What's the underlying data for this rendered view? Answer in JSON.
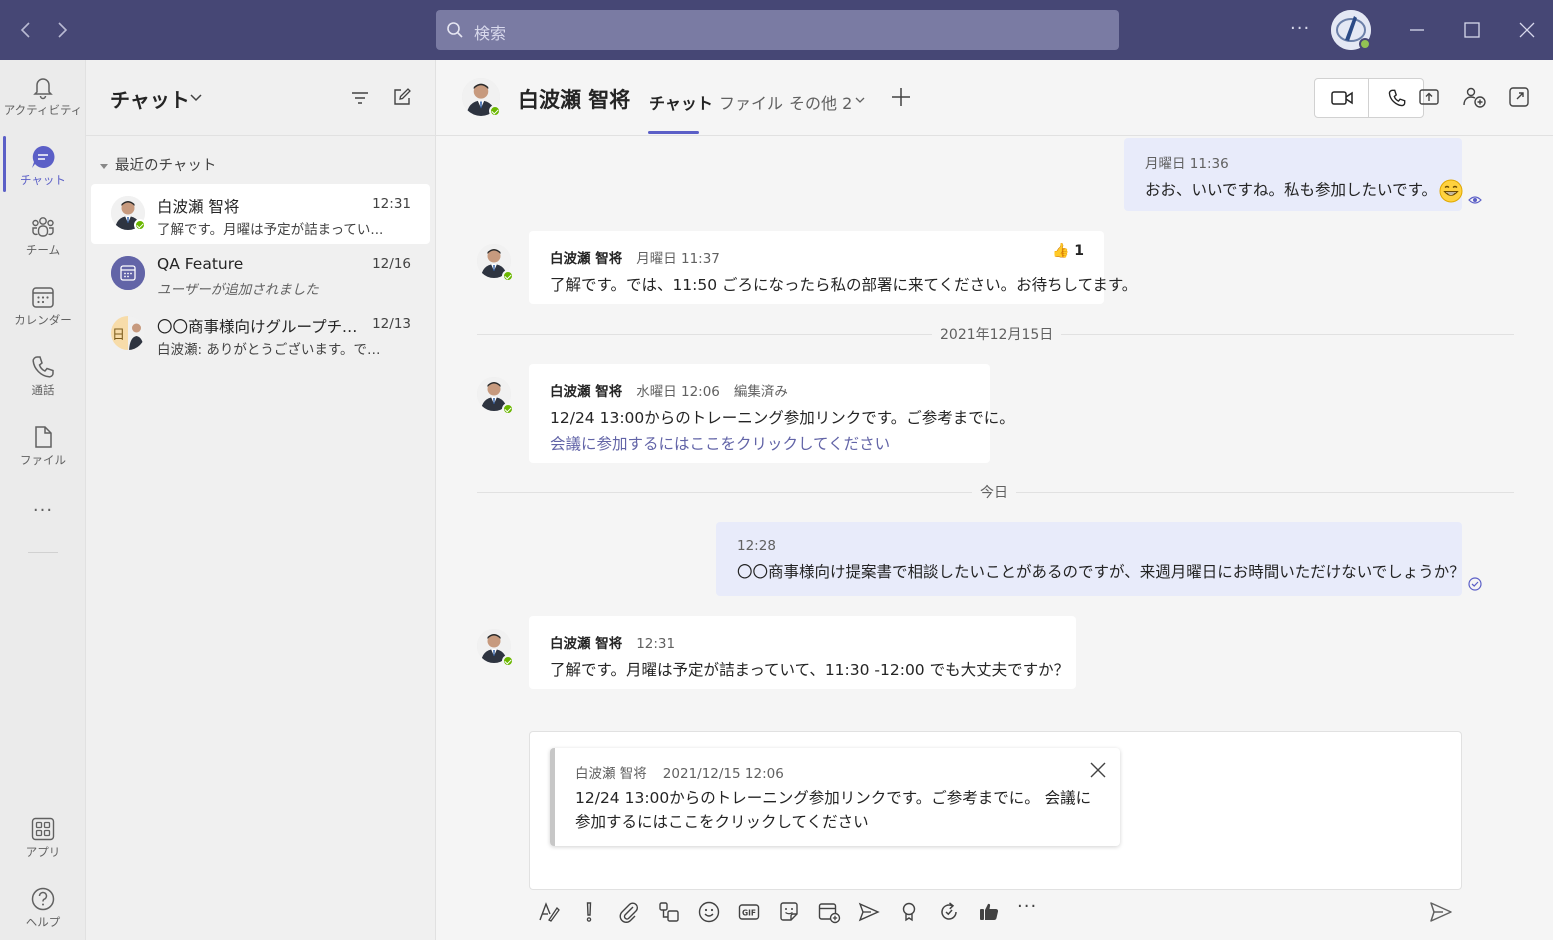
{
  "titlebar": {
    "search_placeholder": "検索",
    "more": "···"
  },
  "rail": {
    "items": [
      {
        "label": "アクティビティ",
        "icon": "bell-icon"
      },
      {
        "label": "チャット",
        "icon": "chat-icon"
      },
      {
        "label": "チーム",
        "icon": "teams-icon"
      },
      {
        "label": "カレンダー",
        "icon": "calendar-icon"
      },
      {
        "label": "通話",
        "icon": "phone-icon"
      },
      {
        "label": "ファイル",
        "icon": "file-icon"
      }
    ],
    "more": "···",
    "apps": {
      "label": "アプリ",
      "icon": "apps-icon"
    },
    "help": {
      "label": "ヘルプ",
      "icon": "help-icon"
    }
  },
  "chatlist": {
    "title": "チャット",
    "section": "最近のチャット",
    "items": [
      {
        "name": "白波瀬 智将",
        "time": "12:31",
        "preview": "了解です。月曜は予定が詰まってい..."
      },
      {
        "name": "QA Feature",
        "time": "12/16",
        "preview": "ユーザーが追加されました"
      },
      {
        "name": "〇〇商事様向けグループチャ...",
        "time": "12/13",
        "preview": "白波瀬: ありがとうございます。では、...",
        "avatar_char": "日"
      }
    ]
  },
  "header": {
    "name": "白波瀬 智将",
    "tabs": [
      "チャット",
      "ファイル",
      "その他 2"
    ]
  },
  "messages": [
    {
      "meta": "月曜日 11:36",
      "text": "おお、いいですね。私も参加したいです。",
      "emoji": "😁"
    },
    {
      "author": "白波瀬 智将",
      "meta": "月曜日 11:37",
      "text": "了解です。では、11:50 ごろになったら私の部署に来てください。お待ちしてます。",
      "reaction": "👍",
      "reaction_count": "1"
    },
    {
      "author": "白波瀬 智将",
      "meta": "水曜日 12:06",
      "edited": "編集済み",
      "text": "12/24 13:00からのトレーニング参加リンクです。ご参考までに。",
      "link": "会議に参加するにはここをクリックしてください"
    },
    {
      "meta": "12:28",
      "text": "〇〇商事様向け提案書で相談したいことがあるのですが、来週月曜日にお時間いただけないでしょうか？"
    },
    {
      "author": "白波瀬 智将",
      "meta": "12:31",
      "text": "了解です。月曜は予定が詰まっていて、11:30 -12:00 でも大丈夫ですか？"
    }
  ],
  "dividers": [
    "2021年12月15日",
    "今日"
  ],
  "compose": {
    "quote_author": "白波瀬 智将",
    "quote_time": "2021/12/15 12:06",
    "quote_text": "12/24 13:00からのトレーニング参加リンクです。ご参考までに。 会議に参加するにはここをクリックしてください"
  },
  "colors": {
    "titlebar": "#464775",
    "accent": "#5b5fc7",
    "link": "#6264a7",
    "online": "#6bb700",
    "mine_bubble": "#e8ebfa"
  }
}
